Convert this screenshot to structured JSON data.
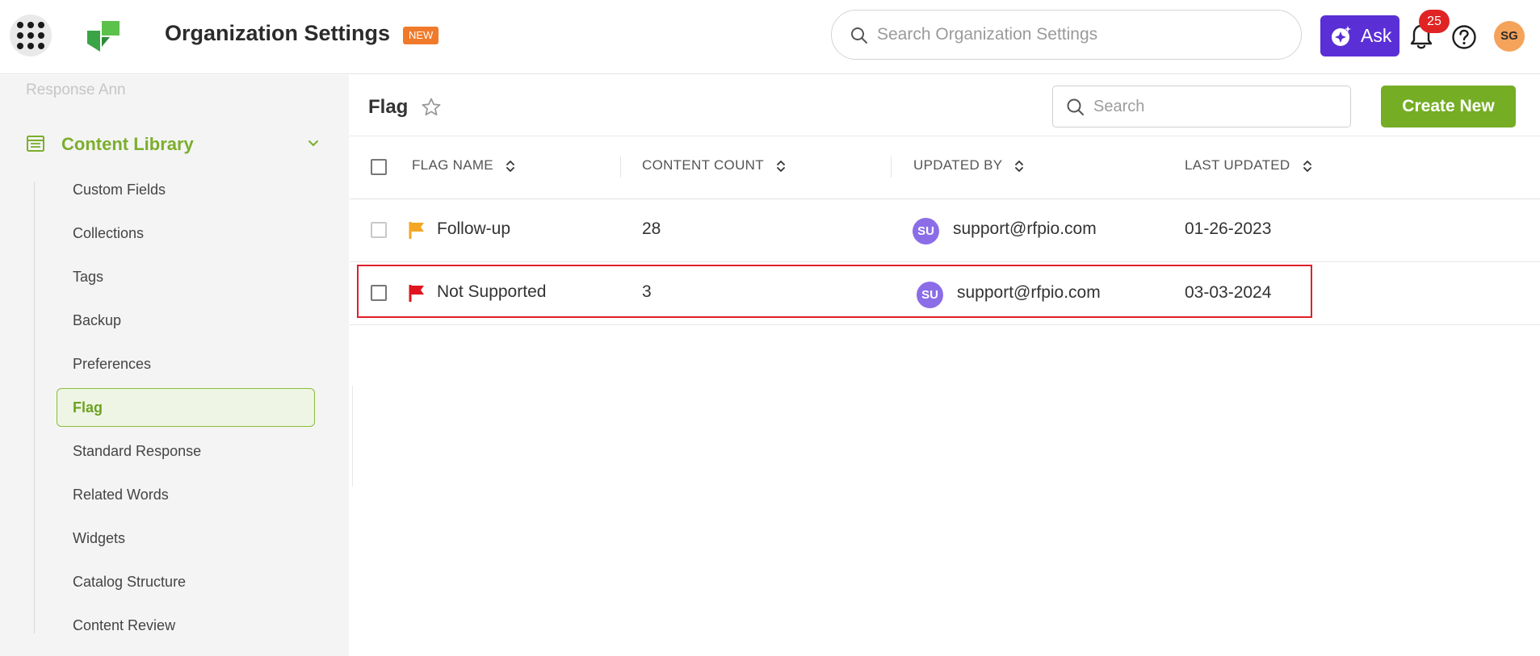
{
  "header": {
    "title": "Organization Settings",
    "badge": "NEW",
    "search_placeholder": "Search Organization Settings",
    "ask_label": "Ask",
    "notification_count": "25",
    "user_initials": "SG"
  },
  "sidebar": {
    "faded_item": "Response Ann",
    "section_label": "Content Library",
    "items": [
      {
        "label": "Custom Fields"
      },
      {
        "label": "Collections"
      },
      {
        "label": "Tags"
      },
      {
        "label": "Backup"
      },
      {
        "label": "Preferences"
      },
      {
        "label": "Flag"
      },
      {
        "label": "Standard Response"
      },
      {
        "label": "Related Words"
      },
      {
        "label": "Widgets"
      },
      {
        "label": "Catalog Structure"
      },
      {
        "label": "Content Review"
      }
    ],
    "active_index": 5
  },
  "main": {
    "page_title": "Flag",
    "search_placeholder": "Search",
    "create_button": "Create New",
    "columns": [
      "FLAG NAME",
      "CONTENT COUNT",
      "UPDATED BY",
      "LAST UPDATED"
    ],
    "rows": [
      {
        "flag_name": "Follow-up",
        "flag_color": "#f5a623",
        "content_count": "28",
        "avatar": "SU",
        "updated_by": "support@rfpio.com",
        "last_updated": "01-26-2023"
      },
      {
        "flag_name": "Not Supported",
        "flag_color": "#e0141e",
        "content_count": "3",
        "avatar": "SU",
        "updated_by": "support@rfpio.com",
        "last_updated": "03-03-2024"
      }
    ]
  },
  "colors": {
    "accent_green": "#75ad25",
    "ask_purple": "#5a2fd6",
    "highlight_red": "#e01f2a"
  }
}
